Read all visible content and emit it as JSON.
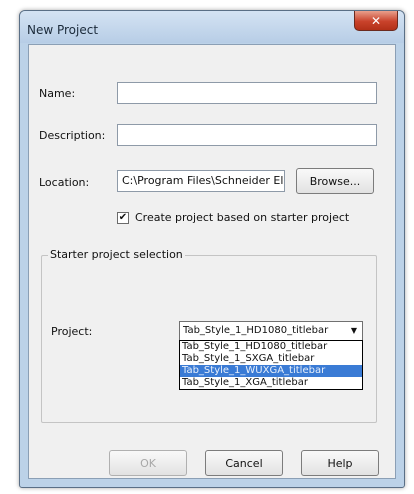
{
  "window": {
    "title": "New Project",
    "close_glyph": "✕"
  },
  "form": {
    "name_label": "Name:",
    "name_value": "",
    "description_label": "Description:",
    "description_value": "",
    "location_label": "Location:",
    "location_value": "C:\\Program Files\\Schneider Ele",
    "browse_label": "Browse...",
    "starter_checkbox_label": "Create project based on starter project",
    "starter_checkbox_checked": true
  },
  "starter": {
    "group_title": "Starter project selection",
    "project_label": "Project:",
    "selected": "Tab_Style_1_HD1080_titlebar",
    "options": [
      "Tab_Style_1_HD1080_titlebar",
      "Tab_Style_1_SXGA_titlebar",
      "Tab_Style_1_WUXGA_titlebar",
      "Tab_Style_1_XGA_titlebar"
    ],
    "highlighted_index": 2
  },
  "footer": {
    "ok_label": "OK",
    "cancel_label": "Cancel",
    "help_label": "Help"
  },
  "colors": {
    "frame": "#bcd2e8",
    "close_button": "#c9422b",
    "highlight": "#3a7bd5"
  }
}
